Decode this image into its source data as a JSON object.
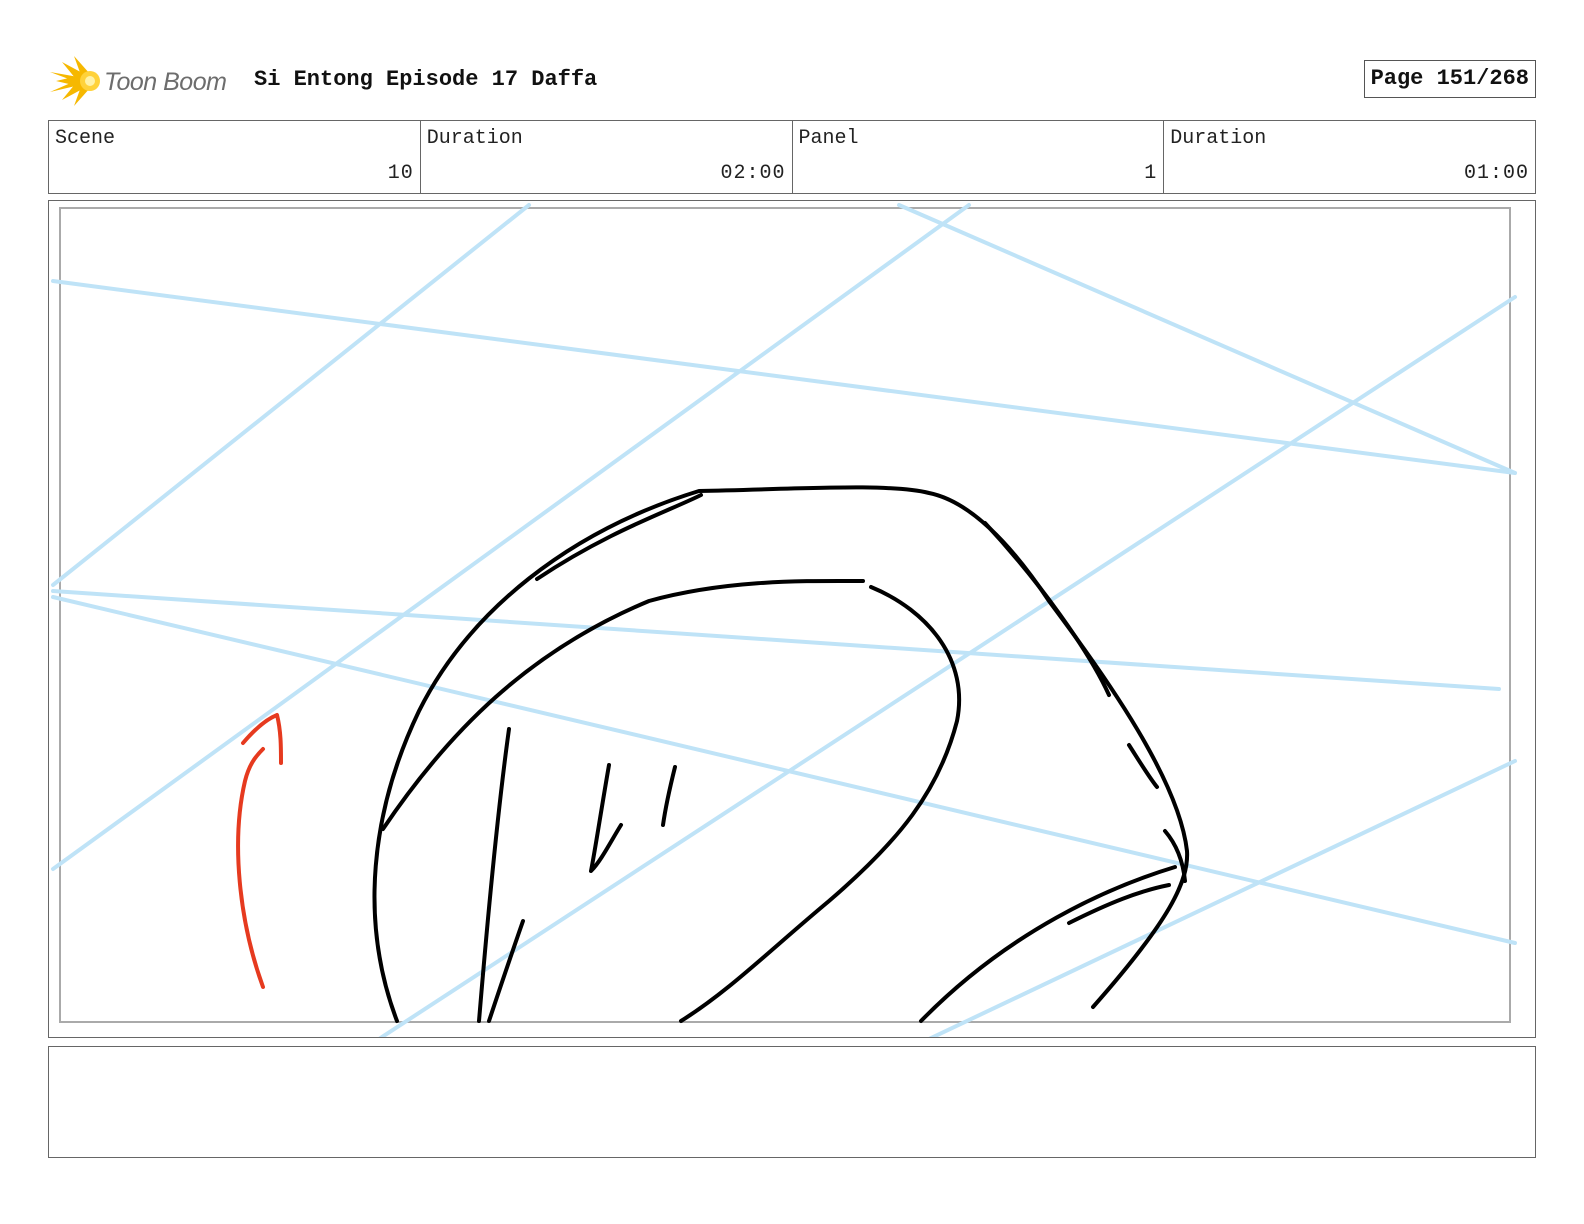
{
  "header": {
    "logo_text": "Toon Boom",
    "title": "Si Entong Episode 17 Daffa",
    "page_label": "Page 151/268"
  },
  "info": {
    "scene_label": "Scene",
    "scene_value": "10",
    "scene_duration_label": "Duration",
    "scene_duration_value": "02:00",
    "panel_label": "Panel",
    "panel_value": "1",
    "panel_duration_label": "Duration",
    "panel_duration_value": "01:00"
  },
  "colors": {
    "guide_lines": "#bfe3f7",
    "sketch": "#000000",
    "arrow": "#e63a1f",
    "logo_burst": "#f5c518"
  },
  "notes": {
    "text": ""
  }
}
